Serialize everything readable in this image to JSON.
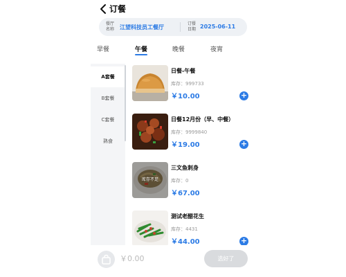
{
  "header": {
    "title": "订餐"
  },
  "info": {
    "restaurant_label": "餐厅名称",
    "restaurant_value": "江望科技员工餐厅",
    "date_label": "订餐日期",
    "date_value": "2025-06-11"
  },
  "meal_tabs": [
    {
      "label": "早餐",
      "active": false
    },
    {
      "label": "午餐",
      "active": true
    },
    {
      "label": "晚餐",
      "active": false
    },
    {
      "label": "夜宵",
      "active": false
    }
  ],
  "sidebar": [
    {
      "label": "A套餐",
      "active": true
    },
    {
      "label": "B套餐",
      "active": false
    },
    {
      "label": "C套餐",
      "active": false
    },
    {
      "label": "熟食",
      "active": false
    }
  ],
  "items": [
    {
      "name": "日餐-午餐",
      "stock": "库存：999733",
      "price": "￥10.00",
      "image": "bread",
      "sold_out": false
    },
    {
      "name": "日餐12月份（早、中餐）",
      "stock": "库存：9999840",
      "price": "￥19.00",
      "image": "chicken",
      "sold_out": false
    },
    {
      "name": "三文鱼刺身",
      "stock": "库存：0",
      "price": "￥67.00",
      "image": "noodle",
      "sold_out": true,
      "sold_out_label": "库存不足"
    },
    {
      "name": "测试老醋花生",
      "stock": "库存：4431",
      "price": "￥44.00",
      "image": "greens",
      "sold_out": false
    }
  ],
  "bottom": {
    "total": "￥0.00",
    "submit_label": "选好了"
  },
  "colors": {
    "accent": "#2c7be5",
    "disabled": "#d9dbde"
  }
}
